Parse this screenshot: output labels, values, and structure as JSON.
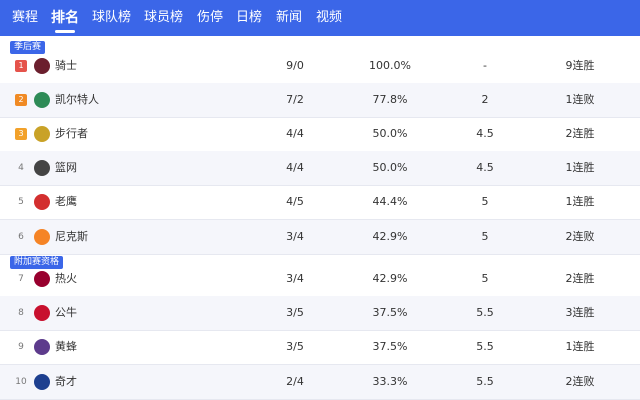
{
  "nav": {
    "tabs": [
      "赛程",
      "排名",
      "球队榜",
      "球员榜",
      "伤停",
      "日榜",
      "新闻",
      "视频"
    ],
    "active_index": 1
  },
  "sections": {
    "playoffs_label": "季后赛",
    "playin_label": "附加赛资格"
  },
  "colors": {
    "accent": "#3b66e8",
    "rank1": "#e5534b",
    "rank2": "#f08a24",
    "rank3": "#f2a12a"
  },
  "teams": [
    {
      "rank": "1",
      "name": "骑士",
      "record": "9/0",
      "pct": "100.0%",
      "gb": "-",
      "streak": "9连胜",
      "logo_color": "#6b1f2e"
    },
    {
      "rank": "2",
      "name": "凯尔特人",
      "record": "7/2",
      "pct": "77.8%",
      "gb": "2",
      "streak": "1连败",
      "logo_color": "#2e8b57"
    },
    {
      "rank": "3",
      "name": "步行者",
      "record": "4/4",
      "pct": "50.0%",
      "gb": "4.5",
      "streak": "2连胜",
      "logo_color": "#c9a227"
    },
    {
      "rank": "4",
      "name": "篮网",
      "record": "4/4",
      "pct": "50.0%",
      "gb": "4.5",
      "streak": "1连胜",
      "logo_color": "#444444"
    },
    {
      "rank": "5",
      "name": "老鹰",
      "record": "4/5",
      "pct": "44.4%",
      "gb": "5",
      "streak": "1连胜",
      "logo_color": "#d32f2f"
    },
    {
      "rank": "6",
      "name": "尼克斯",
      "record": "3/4",
      "pct": "42.9%",
      "gb": "5",
      "streak": "2连败",
      "logo_color": "#f58426"
    },
    {
      "rank": "7",
      "name": "热火",
      "record": "3/4",
      "pct": "42.9%",
      "gb": "5",
      "streak": "2连胜",
      "logo_color": "#98002e"
    },
    {
      "rank": "8",
      "name": "公牛",
      "record": "3/5",
      "pct": "37.5%",
      "gb": "5.5",
      "streak": "3连胜",
      "logo_color": "#c8102e"
    },
    {
      "rank": "9",
      "name": "黄蜂",
      "record": "3/5",
      "pct": "37.5%",
      "gb": "5.5",
      "streak": "1连胜",
      "logo_color": "#5d3b8c"
    },
    {
      "rank": "10",
      "name": "奇才",
      "record": "2/4",
      "pct": "33.3%",
      "gb": "5.5",
      "streak": "2连败",
      "logo_color": "#1d3f8f"
    }
  ]
}
